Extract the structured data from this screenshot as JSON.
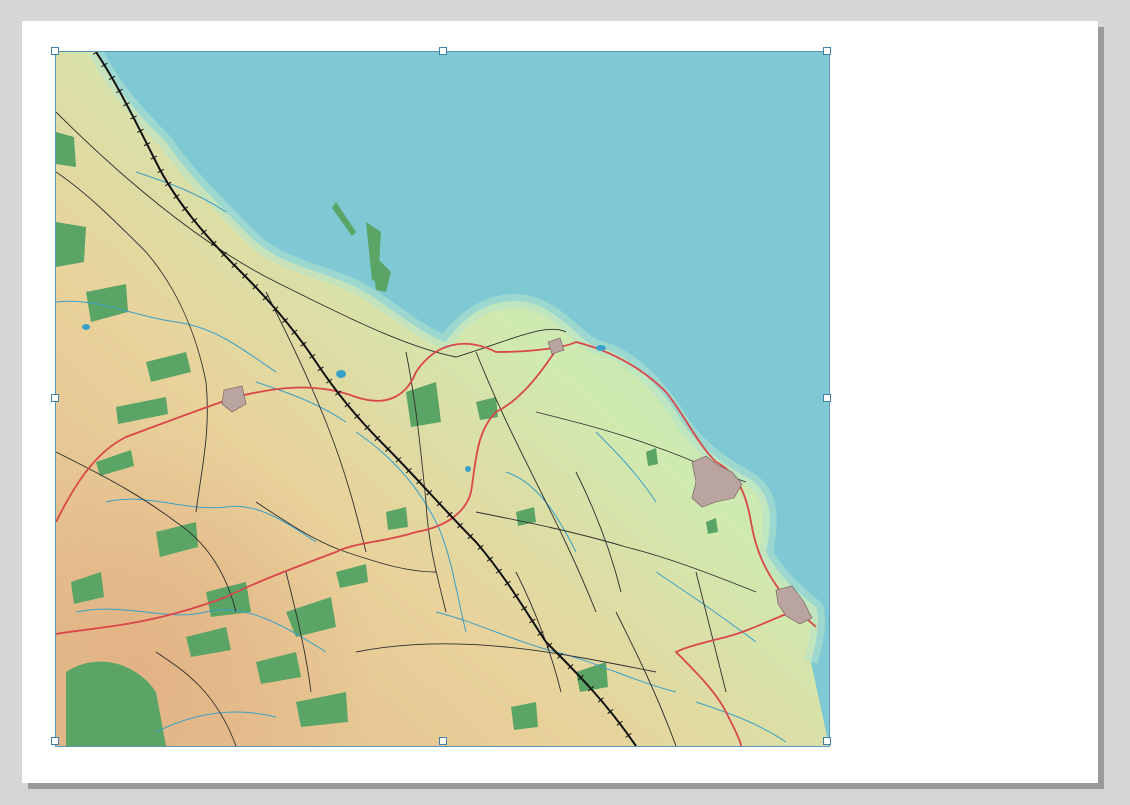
{
  "canvas": {
    "page_background": "#ffffff",
    "workspace_background": "#d6d6d6",
    "selection_color": "#3f7fa8"
  },
  "map_item": {
    "selected": true,
    "layers": {
      "sea_color": "#7ec9d3",
      "land_low_color": "#bfe6b5",
      "land_high_color": "#e8c48e",
      "woodland_color": "#5aa566",
      "major_road_color": "#d9474a",
      "minor_road_color": "#2e2e2e",
      "railway_color": "#111111",
      "stream_color": "#3aa0c8",
      "settlement_color": "#b9a4a0"
    },
    "handles": [
      "top-left",
      "top-center",
      "top-right",
      "middle-left",
      "middle-right",
      "bottom-left",
      "bottom-center",
      "bottom-right"
    ]
  }
}
